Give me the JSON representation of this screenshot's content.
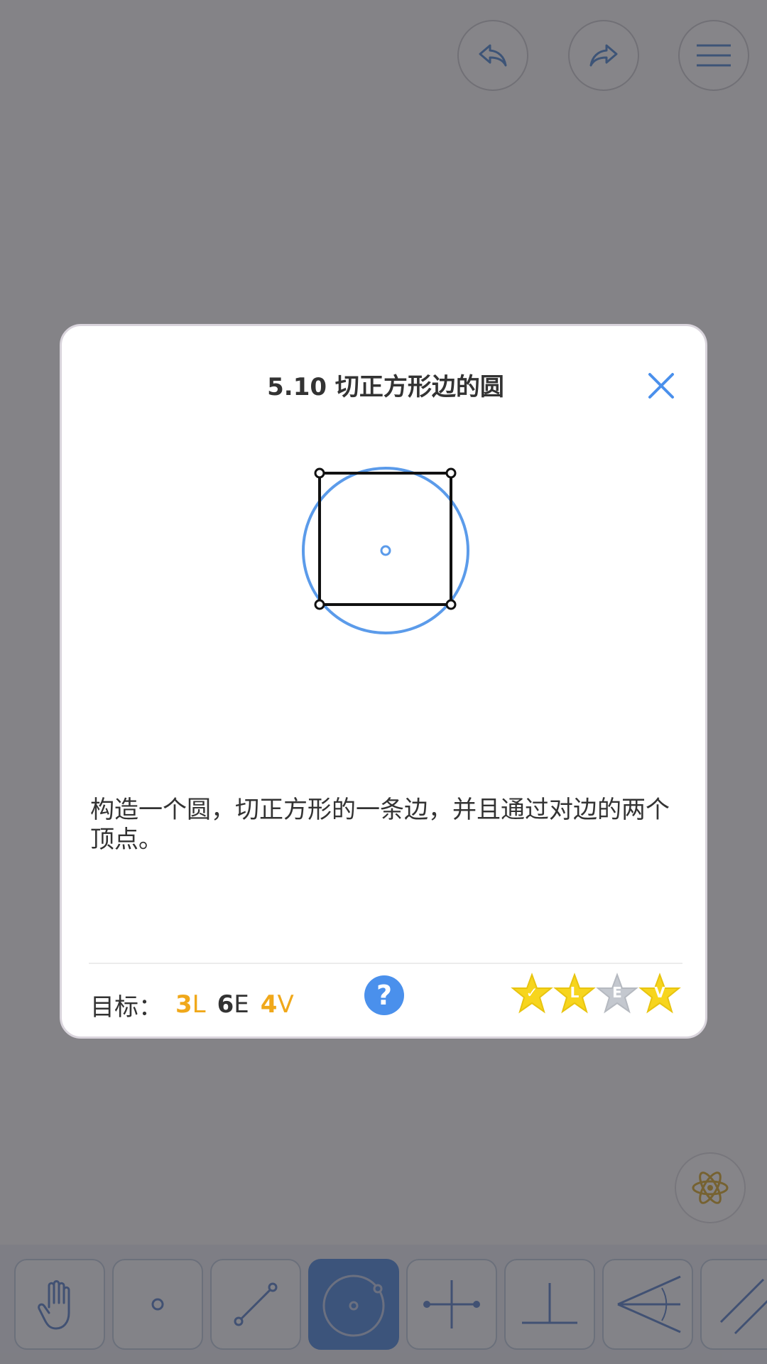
{
  "topbar": {
    "undo_icon": "undo-icon",
    "redo_icon": "redo-icon",
    "menu_icon": "menu-icon"
  },
  "dialog": {
    "title": "5.10 切正方形边的圆",
    "close_icon": "close-icon",
    "description": "构造一个圆，切正方形的一条边，并且通过对边的两个顶点。",
    "goals": {
      "label": "目标：",
      "items": [
        {
          "num": "3",
          "unit": "L",
          "color": "#f0a81a"
        },
        {
          "num": "6",
          "unit": "E",
          "color": "#333333"
        },
        {
          "num": "4",
          "unit": "V",
          "color": "#f0a81a"
        }
      ]
    },
    "help_label": "?",
    "stars": [
      {
        "mark": "✓",
        "earned": true
      },
      {
        "mark": "L",
        "earned": true
      },
      {
        "mark": "E",
        "earned": false
      },
      {
        "mark": "V",
        "earned": true
      }
    ]
  },
  "toolbar": {
    "tools": [
      "hand-tool",
      "point-tool",
      "line-tool",
      "circle-tool",
      "perpendicular-bisector-tool",
      "perpendicular-tool",
      "angle-bisector-tool",
      "parallel-tool"
    ],
    "active_tool": "circle-tool"
  },
  "colors": {
    "accent": "#4a90ec",
    "star_gold": "#f7d51d",
    "goal_orange": "#f0a81a",
    "overlay": "#86848a"
  }
}
